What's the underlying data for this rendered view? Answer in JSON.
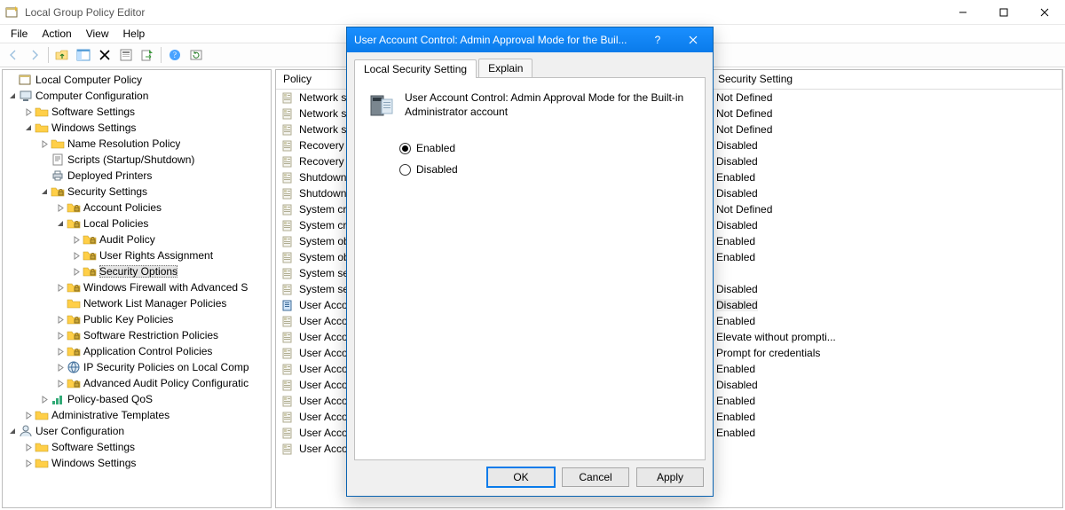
{
  "window": {
    "title": "Local Group Policy Editor",
    "menus": [
      "File",
      "Action",
      "View",
      "Help"
    ]
  },
  "toolbar": {
    "icons": [
      {
        "name": "back-icon",
        "disabled": true
      },
      {
        "name": "forward-icon",
        "disabled": true
      },
      {
        "name": "sep"
      },
      {
        "name": "up-icon"
      },
      {
        "name": "show-hide-tree-icon"
      },
      {
        "name": "delete-icon"
      },
      {
        "name": "properties-icon"
      },
      {
        "name": "export-icon"
      },
      {
        "name": "sep"
      },
      {
        "name": "help-icon"
      },
      {
        "name": "refresh-icon"
      }
    ]
  },
  "tree": [
    {
      "depth": 0,
      "exp": "",
      "icon": "policy",
      "label": "Local Computer Policy"
    },
    {
      "depth": 0,
      "exp": "open",
      "icon": "computer",
      "label": "Computer Configuration"
    },
    {
      "depth": 1,
      "exp": "closed",
      "icon": "folder",
      "label": "Software Settings"
    },
    {
      "depth": 1,
      "exp": "open",
      "icon": "folder",
      "label": "Windows Settings"
    },
    {
      "depth": 2,
      "exp": "closed",
      "icon": "folder",
      "label": "Name Resolution Policy"
    },
    {
      "depth": 2,
      "exp": "",
      "icon": "script",
      "label": "Scripts (Startup/Shutdown)"
    },
    {
      "depth": 2,
      "exp": "",
      "icon": "printer",
      "label": "Deployed Printers"
    },
    {
      "depth": 2,
      "exp": "open",
      "icon": "secfolder",
      "label": "Security Settings"
    },
    {
      "depth": 3,
      "exp": "closed",
      "icon": "secfolder",
      "label": "Account Policies"
    },
    {
      "depth": 3,
      "exp": "open",
      "icon": "secfolder",
      "label": "Local Policies"
    },
    {
      "depth": 4,
      "exp": "closed",
      "icon": "secfolder",
      "label": "Audit Policy"
    },
    {
      "depth": 4,
      "exp": "closed",
      "icon": "secfolder",
      "label": "User Rights Assignment"
    },
    {
      "depth": 4,
      "exp": "closed",
      "icon": "secfolder",
      "label": "Security Options",
      "selected": true
    },
    {
      "depth": 3,
      "exp": "closed",
      "icon": "secfolder",
      "label": "Windows Firewall with Advanced S"
    },
    {
      "depth": 3,
      "exp": "",
      "icon": "folder",
      "label": "Network List Manager Policies"
    },
    {
      "depth": 3,
      "exp": "closed",
      "icon": "secfolder",
      "label": "Public Key Policies"
    },
    {
      "depth": 3,
      "exp": "closed",
      "icon": "secfolder",
      "label": "Software Restriction Policies"
    },
    {
      "depth": 3,
      "exp": "closed",
      "icon": "secfolder",
      "label": "Application Control Policies"
    },
    {
      "depth": 3,
      "exp": "closed",
      "icon": "ipsec",
      "label": "IP Security Policies on Local Comp"
    },
    {
      "depth": 3,
      "exp": "closed",
      "icon": "secfolder",
      "label": "Advanced Audit Policy Configuratic"
    },
    {
      "depth": 2,
      "exp": "closed",
      "icon": "qos",
      "label": "Policy-based QoS"
    },
    {
      "depth": 1,
      "exp": "closed",
      "icon": "folder",
      "label": "Administrative Templates"
    },
    {
      "depth": 0,
      "exp": "open",
      "icon": "user",
      "label": "User Configuration"
    },
    {
      "depth": 1,
      "exp": "closed",
      "icon": "folder",
      "label": "Software Settings"
    },
    {
      "depth": 1,
      "exp": "closed",
      "icon": "folder",
      "label": "Windows Settings"
    }
  ],
  "list": {
    "columns": [
      "Policy",
      "Security Setting"
    ],
    "rows": [
      {
        "policy": "Network sec",
        "setting": "Not Defined"
      },
      {
        "policy": "Network sec",
        "setting": "Not Defined"
      },
      {
        "policy": "Network sec",
        "setting": "Not Defined"
      },
      {
        "policy": "Recovery co",
        "setting": "Disabled"
      },
      {
        "policy": "Recovery co",
        "setting": "Disabled"
      },
      {
        "policy": "Shutdown: A",
        "setting": "Enabled"
      },
      {
        "policy": "Shutdown: C",
        "setting": "Disabled"
      },
      {
        "policy": "System cryp",
        "setting": "Not Defined"
      },
      {
        "policy": "System cryp",
        "setting": "Disabled"
      },
      {
        "policy": "System obje",
        "setting": "Enabled"
      },
      {
        "policy": "System obje",
        "setting": "Enabled"
      },
      {
        "policy": "System setti",
        "setting": ""
      },
      {
        "policy": "System setti",
        "setting": "Disabled"
      },
      {
        "policy": "User Accour",
        "setting": "Disabled",
        "highlight": true,
        "selectedPolicy": true
      },
      {
        "policy": "User Accour",
        "setting": "Enabled"
      },
      {
        "policy": "User Accour",
        "setting": "Elevate without prompti..."
      },
      {
        "policy": "User Accour",
        "setting": "Prompt for credentials"
      },
      {
        "policy": "User Accour",
        "setting": "Enabled"
      },
      {
        "policy": "User Accour",
        "setting": "Disabled"
      },
      {
        "policy": "User Accour",
        "setting": "Enabled"
      },
      {
        "policy": "User Accour",
        "setting": "Enabled"
      },
      {
        "policy": "User Accour",
        "setting": "Enabled"
      },
      {
        "policy": "User Accour",
        "setting": ""
      }
    ]
  },
  "dialog": {
    "title": "User Account Control: Admin Approval Mode for the Buil...",
    "tabs": [
      "Local Security Setting",
      "Explain"
    ],
    "activeTab": 0,
    "headerText": "User Account Control: Admin Approval Mode for the Built-in Administrator account",
    "radios": [
      {
        "label": "Enabled",
        "checked": true
      },
      {
        "label": "Disabled",
        "checked": false
      }
    ],
    "buttons": {
      "ok": "OK",
      "cancel": "Cancel",
      "apply": "Apply"
    }
  }
}
